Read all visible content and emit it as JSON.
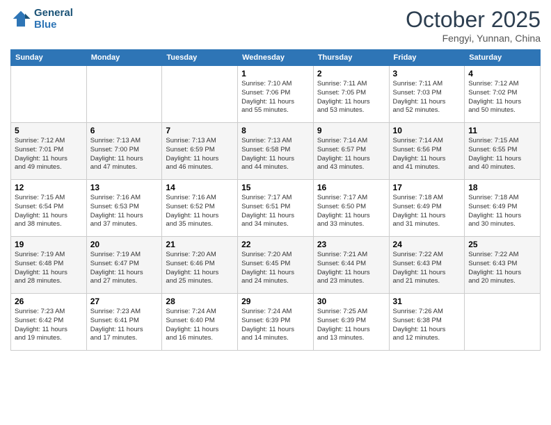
{
  "logo": {
    "line1": "General",
    "line2": "Blue"
  },
  "title": "October 2025",
  "subtitle": "Fengyi, Yunnan, China",
  "days_of_week": [
    "Sunday",
    "Monday",
    "Tuesday",
    "Wednesday",
    "Thursday",
    "Friday",
    "Saturday"
  ],
  "weeks": [
    [
      {
        "day": "",
        "info": ""
      },
      {
        "day": "",
        "info": ""
      },
      {
        "day": "",
        "info": ""
      },
      {
        "day": "1",
        "info": "Sunrise: 7:10 AM\nSunset: 7:06 PM\nDaylight: 11 hours\nand 55 minutes."
      },
      {
        "day": "2",
        "info": "Sunrise: 7:11 AM\nSunset: 7:05 PM\nDaylight: 11 hours\nand 53 minutes."
      },
      {
        "day": "3",
        "info": "Sunrise: 7:11 AM\nSunset: 7:03 PM\nDaylight: 11 hours\nand 52 minutes."
      },
      {
        "day": "4",
        "info": "Sunrise: 7:12 AM\nSunset: 7:02 PM\nDaylight: 11 hours\nand 50 minutes."
      }
    ],
    [
      {
        "day": "5",
        "info": "Sunrise: 7:12 AM\nSunset: 7:01 PM\nDaylight: 11 hours\nand 49 minutes."
      },
      {
        "day": "6",
        "info": "Sunrise: 7:13 AM\nSunset: 7:00 PM\nDaylight: 11 hours\nand 47 minutes."
      },
      {
        "day": "7",
        "info": "Sunrise: 7:13 AM\nSunset: 6:59 PM\nDaylight: 11 hours\nand 46 minutes."
      },
      {
        "day": "8",
        "info": "Sunrise: 7:13 AM\nSunset: 6:58 PM\nDaylight: 11 hours\nand 44 minutes."
      },
      {
        "day": "9",
        "info": "Sunrise: 7:14 AM\nSunset: 6:57 PM\nDaylight: 11 hours\nand 43 minutes."
      },
      {
        "day": "10",
        "info": "Sunrise: 7:14 AM\nSunset: 6:56 PM\nDaylight: 11 hours\nand 41 minutes."
      },
      {
        "day": "11",
        "info": "Sunrise: 7:15 AM\nSunset: 6:55 PM\nDaylight: 11 hours\nand 40 minutes."
      }
    ],
    [
      {
        "day": "12",
        "info": "Sunrise: 7:15 AM\nSunset: 6:54 PM\nDaylight: 11 hours\nand 38 minutes."
      },
      {
        "day": "13",
        "info": "Sunrise: 7:16 AM\nSunset: 6:53 PM\nDaylight: 11 hours\nand 37 minutes."
      },
      {
        "day": "14",
        "info": "Sunrise: 7:16 AM\nSunset: 6:52 PM\nDaylight: 11 hours\nand 35 minutes."
      },
      {
        "day": "15",
        "info": "Sunrise: 7:17 AM\nSunset: 6:51 PM\nDaylight: 11 hours\nand 34 minutes."
      },
      {
        "day": "16",
        "info": "Sunrise: 7:17 AM\nSunset: 6:50 PM\nDaylight: 11 hours\nand 33 minutes."
      },
      {
        "day": "17",
        "info": "Sunrise: 7:18 AM\nSunset: 6:49 PM\nDaylight: 11 hours\nand 31 minutes."
      },
      {
        "day": "18",
        "info": "Sunrise: 7:18 AM\nSunset: 6:49 PM\nDaylight: 11 hours\nand 30 minutes."
      }
    ],
    [
      {
        "day": "19",
        "info": "Sunrise: 7:19 AM\nSunset: 6:48 PM\nDaylight: 11 hours\nand 28 minutes."
      },
      {
        "day": "20",
        "info": "Sunrise: 7:19 AM\nSunset: 6:47 PM\nDaylight: 11 hours\nand 27 minutes."
      },
      {
        "day": "21",
        "info": "Sunrise: 7:20 AM\nSunset: 6:46 PM\nDaylight: 11 hours\nand 25 minutes."
      },
      {
        "day": "22",
        "info": "Sunrise: 7:20 AM\nSunset: 6:45 PM\nDaylight: 11 hours\nand 24 minutes."
      },
      {
        "day": "23",
        "info": "Sunrise: 7:21 AM\nSunset: 6:44 PM\nDaylight: 11 hours\nand 23 minutes."
      },
      {
        "day": "24",
        "info": "Sunrise: 7:22 AM\nSunset: 6:43 PM\nDaylight: 11 hours\nand 21 minutes."
      },
      {
        "day": "25",
        "info": "Sunrise: 7:22 AM\nSunset: 6:43 PM\nDaylight: 11 hours\nand 20 minutes."
      }
    ],
    [
      {
        "day": "26",
        "info": "Sunrise: 7:23 AM\nSunset: 6:42 PM\nDaylight: 11 hours\nand 19 minutes."
      },
      {
        "day": "27",
        "info": "Sunrise: 7:23 AM\nSunset: 6:41 PM\nDaylight: 11 hours\nand 17 minutes."
      },
      {
        "day": "28",
        "info": "Sunrise: 7:24 AM\nSunset: 6:40 PM\nDaylight: 11 hours\nand 16 minutes."
      },
      {
        "day": "29",
        "info": "Sunrise: 7:24 AM\nSunset: 6:39 PM\nDaylight: 11 hours\nand 14 minutes."
      },
      {
        "day": "30",
        "info": "Sunrise: 7:25 AM\nSunset: 6:39 PM\nDaylight: 11 hours\nand 13 minutes."
      },
      {
        "day": "31",
        "info": "Sunrise: 7:26 AM\nSunset: 6:38 PM\nDaylight: 11 hours\nand 12 minutes."
      },
      {
        "day": "",
        "info": ""
      }
    ]
  ]
}
